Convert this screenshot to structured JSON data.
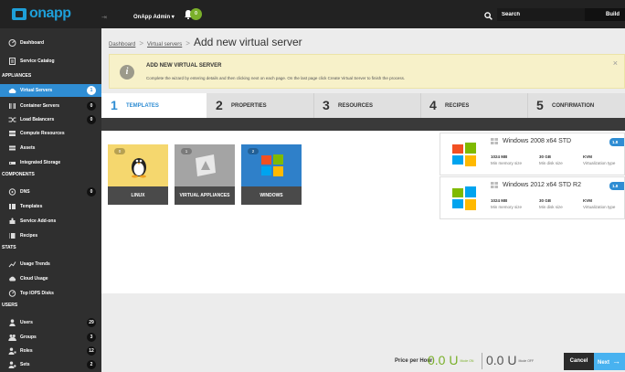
{
  "brand": {
    "logo_text": "onapp"
  },
  "topbar": {
    "collapse_icon": "double-chevron-right-icon",
    "account_label": "OnApp Admin ▾",
    "notifications_count": "0",
    "search_placeholder": "Search",
    "build_label": "Build"
  },
  "sidebar": {
    "top_items": [
      {
        "label": "Dashboard",
        "icon": "dashboard-icon"
      },
      {
        "label": "Service Catalog",
        "icon": "catalog-icon"
      }
    ],
    "sections": {
      "appliances": "APPLIANCES",
      "components": "COMPONENTS",
      "stats": "STATS",
      "users": "USERS"
    },
    "appliances": [
      {
        "label": "Virtual Servers",
        "count": "1",
        "icon": "cloud-icon",
        "active": true
      },
      {
        "label": "Container Servers",
        "count": "0",
        "icon": "container-icon"
      },
      {
        "label": "Load Balancers",
        "count": "0",
        "icon": "shuffle-icon"
      },
      {
        "label": "Compute Resources",
        "icon": "server-icon"
      },
      {
        "label": "Assets",
        "icon": "assets-icon"
      },
      {
        "label": "Integrated Storage",
        "icon": "storage-icon"
      }
    ],
    "components": [
      {
        "label": "DNS",
        "count": "0",
        "icon": "dns-icon"
      },
      {
        "label": "Templates",
        "icon": "templates-icon"
      },
      {
        "label": "Service Add-ons",
        "icon": "puzzle-icon"
      },
      {
        "label": "Recipes",
        "icon": "book-icon"
      }
    ],
    "stats": [
      {
        "label": "Usage Trends",
        "icon": "trend-icon"
      },
      {
        "label": "Cloud Usage",
        "icon": "cloud-usage-icon"
      },
      {
        "label": "Top IOPS Disks",
        "icon": "gauge-icon"
      }
    ],
    "users": [
      {
        "label": "Users",
        "count": "29",
        "icon": "user-icon"
      },
      {
        "label": "Groups",
        "count": "3",
        "icon": "group-icon"
      },
      {
        "label": "Roles",
        "count": "12",
        "icon": "roles-icon"
      },
      {
        "label": "Sets",
        "count": "2",
        "icon": "sets-icon"
      }
    ]
  },
  "breadcrumb": {
    "items": [
      "Dashboard",
      "Virtual servers"
    ],
    "separator": ">",
    "current": "Add new virtual server"
  },
  "notice": {
    "title": "ADD NEW VIRTUAL SERVER",
    "body": "Complete the wizard by entering details and then clicking next on each page. On the last page click Create Virtual Server to finish the process.",
    "close": "×"
  },
  "steps": [
    {
      "num": "1",
      "label": "TEMPLATES",
      "active": true
    },
    {
      "num": "2",
      "label": "PROPERTIES"
    },
    {
      "num": "3",
      "label": "RESOURCES"
    },
    {
      "num": "4",
      "label": "RECIPES"
    },
    {
      "num": "5",
      "label": "CONFIRMATION"
    }
  ],
  "template_groups": [
    {
      "label": "LINUX",
      "count": "0",
      "icon": "linux-penguin-icon",
      "color": "#f5d76e"
    },
    {
      "label": "VIRTUAL APPLIANCES",
      "count": "1",
      "icon": "virtual-appliance-icon",
      "color": "#a4a4a4"
    },
    {
      "label": "WINDOWS",
      "count": "2",
      "icon": "windows-logo-icon",
      "color": "#2f80c9"
    }
  ],
  "templates": [
    {
      "name": "Windows 2008 x64 STD",
      "version": "1.8",
      "memory": "1024 MB",
      "memory_label": "Min memory size",
      "disk": "30 GB",
      "disk_label": "Min disk size",
      "virt": "KVM",
      "virt_label": "Virtualization type"
    },
    {
      "name": "Windows 2012 x64 STD R2",
      "version": "1.8",
      "memory": "1024 MB",
      "memory_label": "Min memory size",
      "disk": "30 GB",
      "disk_label": "Min disk size",
      "virt": "KVM",
      "virt_label": "Virtualization type"
    }
  ],
  "footer": {
    "price_label": "Price per Hour:",
    "price_on": "0.0 U",
    "price_on_unit": "Mode ON",
    "price_off": "0.0 U",
    "price_off_unit": "Mode OFF",
    "cancel": "Cancel",
    "next": "Next",
    "next_arrow": "→"
  },
  "colors": {
    "accent": "#2f8dd3",
    "success": "#7ab02a",
    "sidebar": "#2f2f2f",
    "topbar": "#222222"
  }
}
